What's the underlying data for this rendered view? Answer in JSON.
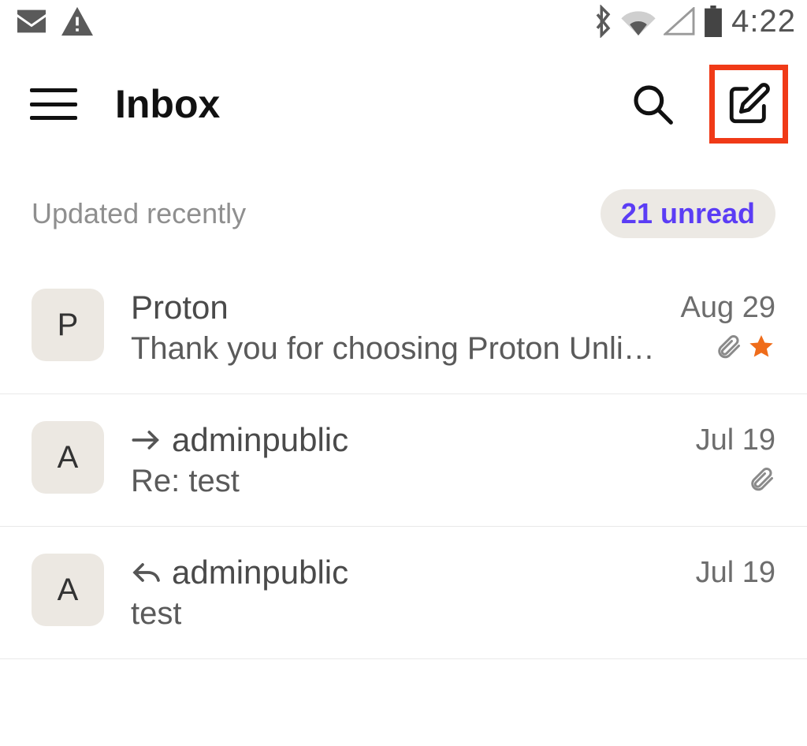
{
  "status_bar": {
    "time": "4:22"
  },
  "header": {
    "title": "Inbox"
  },
  "update": {
    "text": "Updated recently",
    "unread": "21 unread"
  },
  "emails": [
    {
      "avatar_letter": "P",
      "sender": "Proton",
      "date": "Aug 29",
      "subject": "Thank you for choosing Proton Unli…",
      "has_attachment": true,
      "starred": true,
      "direction": "none"
    },
    {
      "avatar_letter": "A",
      "sender": "adminpublic",
      "date": "Jul 19",
      "subject": "Re: test",
      "has_attachment": true,
      "starred": false,
      "direction": "forward"
    },
    {
      "avatar_letter": "A",
      "sender": "adminpublic",
      "date": "Jul 19",
      "subject": "test",
      "has_attachment": false,
      "starred": false,
      "direction": "reply"
    }
  ]
}
